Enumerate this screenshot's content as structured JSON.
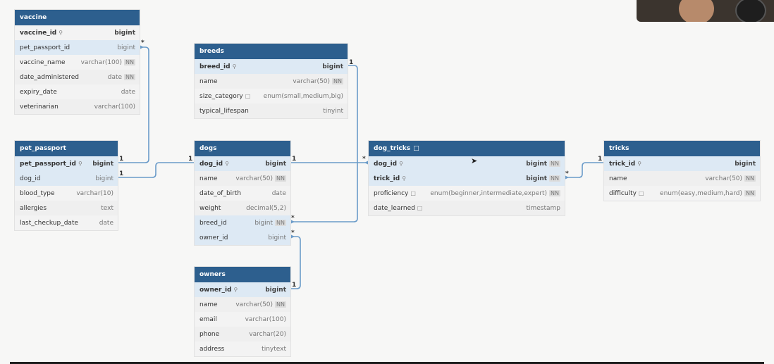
{
  "tables": {
    "vaccine": {
      "name": "vaccine",
      "columns": [
        {
          "name": "vaccine_id",
          "type": "bigint",
          "pk": true,
          "key": true,
          "nn": false
        },
        {
          "name": "pet_passport_id",
          "type": "bigint",
          "nn": false
        },
        {
          "name": "vaccine_name",
          "type": "varchar(100)",
          "nn": true
        },
        {
          "name": "date_administered",
          "type": "date",
          "nn": true
        },
        {
          "name": "expiry_date",
          "type": "date",
          "nn": false
        },
        {
          "name": "veterinarian",
          "type": "varchar(100)",
          "nn": false
        }
      ]
    },
    "breeds": {
      "name": "breeds",
      "columns": [
        {
          "name": "breed_id",
          "type": "bigint",
          "pk": true,
          "key": true
        },
        {
          "name": "name",
          "type": "varchar(50)",
          "nn": true
        },
        {
          "name": "size_category",
          "type": "enum(small,medium,big)",
          "note": true
        },
        {
          "name": "typical_lifespan",
          "type": "tinyint"
        }
      ]
    },
    "pet_passport": {
      "name": "pet_passport",
      "columns": [
        {
          "name": "pet_passport_id",
          "type": "bigint",
          "pk": true,
          "key": true
        },
        {
          "name": "dog_id",
          "type": "bigint"
        },
        {
          "name": "blood_type",
          "type": "varchar(10)"
        },
        {
          "name": "allergies",
          "type": "text"
        },
        {
          "name": "last_checkup_date",
          "type": "date"
        }
      ]
    },
    "dogs": {
      "name": "dogs",
      "columns": [
        {
          "name": "dog_id",
          "type": "bigint",
          "pk": true,
          "key": true
        },
        {
          "name": "name",
          "type": "varchar(50)",
          "nn": true
        },
        {
          "name": "date_of_birth",
          "type": "date"
        },
        {
          "name": "weight",
          "type": "decimal(5,2)"
        },
        {
          "name": "breed_id",
          "type": "bigint",
          "nn": true
        },
        {
          "name": "owner_id",
          "type": "bigint"
        }
      ]
    },
    "dog_tricks": {
      "name": "dog_tricks",
      "note": true,
      "columns": [
        {
          "name": "dog_id",
          "type": "bigint",
          "pk": true,
          "key": true,
          "nn": true
        },
        {
          "name": "trick_id",
          "type": "bigint",
          "pk": true,
          "key": true,
          "nn": true
        },
        {
          "name": "proficiency",
          "type": "enum(beginner,intermediate,expert)",
          "note": true,
          "nn": true
        },
        {
          "name": "date_learned",
          "type": "timestamp",
          "note": true
        }
      ]
    },
    "tricks": {
      "name": "tricks",
      "columns": [
        {
          "name": "trick_id",
          "type": "bigint",
          "pk": true,
          "key": true
        },
        {
          "name": "name",
          "type": "varchar(50)",
          "nn": true
        },
        {
          "name": "difficulty",
          "type": "enum(easy,medium,hard)",
          "note": true,
          "nn": true
        }
      ]
    },
    "owners": {
      "name": "owners",
      "columns": [
        {
          "name": "owner_id",
          "type": "bigint",
          "pk": true,
          "key": true
        },
        {
          "name": "name",
          "type": "varchar(50)",
          "nn": true
        },
        {
          "name": "email",
          "type": "varchar(100)"
        },
        {
          "name": "phone",
          "type": "varchar(20)"
        },
        {
          "name": "address",
          "type": "tinytext"
        }
      ]
    }
  },
  "nn_label": "NN",
  "cardinality": {
    "one": "1",
    "many": "*"
  },
  "colors": {
    "header": "#2d5f8e",
    "link": "#6a9bc9",
    "highlight": "#dde9f4"
  },
  "icons": {
    "key": "key-icon",
    "note": "note-icon"
  }
}
